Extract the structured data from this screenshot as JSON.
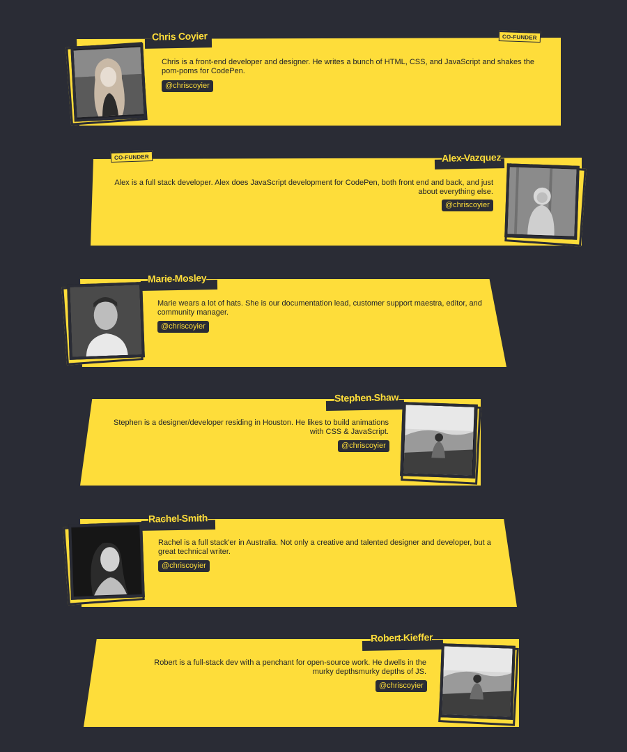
{
  "colors": {
    "background": "#2a2c35",
    "accent": "#fedd3a",
    "text": "#22232a"
  },
  "team": [
    {
      "name": "Chris Coyier",
      "badge": "CO-FUNDER",
      "description": "Chris is a front-end developer and designer. He writes a bunch of HTML, CSS, and JavaScript and shakes the pom-poms for CodePen.",
      "handle": "@chriscoyier",
      "photo_icon": "woman-portrait-photo"
    },
    {
      "name": "Alex Vazquez",
      "badge": "CO-FUNDER",
      "description": "Alex is a full stack developer. Alex does JavaScript development for CodePen, both front end and back, and just about everything else.",
      "handle": "@chriscoyier",
      "photo_icon": "man-hoodie-photo"
    },
    {
      "name": "Marie Mosley",
      "badge": "",
      "description": "Marie wears a lot of hats. She is our documentation lead, customer support maestra, editor, and community manager.",
      "handle": "@chriscoyier",
      "photo_icon": "man-portrait-photo"
    },
    {
      "name": "Stephen Shaw",
      "badge": "",
      "description": "Stephen is a designer/developer residing in Houston. He likes to build animations with CSS & JavaScript.",
      "handle": "@chriscoyier",
      "photo_icon": "man-on-cliff-photo"
    },
    {
      "name": "Rachel Smith",
      "badge": "",
      "description": "Rachel is a full stack'er in Australia. Not only a creative and talented designer and developer, but a great technical writer.",
      "handle": "@chriscoyier",
      "photo_icon": "woman-dark-portrait-photo"
    },
    {
      "name": "Robert Kieffer",
      "badge": "",
      "description": "Robert is a full-stack dev with a penchant for open-source work. He dwells in the murky depthsmurky depths of JS.",
      "handle": "@chriscoyier",
      "photo_icon": "man-on-cliff-photo"
    }
  ]
}
